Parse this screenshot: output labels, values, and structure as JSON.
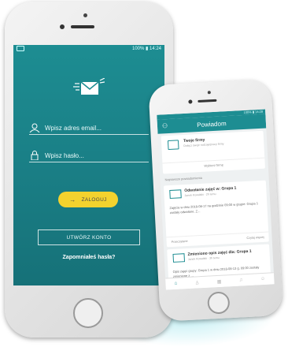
{
  "login": {
    "status_right": "100% ▮ 14:24",
    "email_placeholder": "Wpisz adres email...",
    "password_placeholder": "Wpisz hasło...",
    "login_label": "ZALOGUJ",
    "create_account_label": "UTWÓRZ KONTO",
    "forgot_label": "Zapomniałeś hasła?",
    "colors": {
      "accent": "#1d8d92",
      "button": "#f3d22e"
    }
  },
  "notifications": {
    "status_right": "100% ▮ 14:28",
    "title": "Powiadom",
    "card_company": {
      "title": "Twoje firmy",
      "subtitle": "Dołącz swoje rodzaje/pracy firmy",
      "link": "Wybierz firmę"
    },
    "section_label": "Najnowsze powiadomienia",
    "card_cancel": {
      "title": "Odwołanie zajęć w: Grupa 1",
      "subtitle": "Janek Kowalski · 2h temu",
      "body": "Zajęcia w dniu 2018-08-17 na godzinie 09:00 w grupie: Grupa 1 zostały odwołane. Z...",
      "action_left": "Przeczytane",
      "action_right": "Czytaj więcej"
    },
    "card_change": {
      "title": "Zmieniono opis zajęć dla: Grupa 1",
      "subtitle": "Janek Kowalski · 3h temu",
      "body": "Opis zajęć grupy: Grupa 1 w dniu 2018-08-13 g. 09:00 zostały zmienione z ..."
    }
  },
  "icons": [
    "user-icon",
    "lock-icon",
    "arrow-right-icon",
    "mail-logo-icon",
    "bell-icon",
    "home-icon"
  ]
}
